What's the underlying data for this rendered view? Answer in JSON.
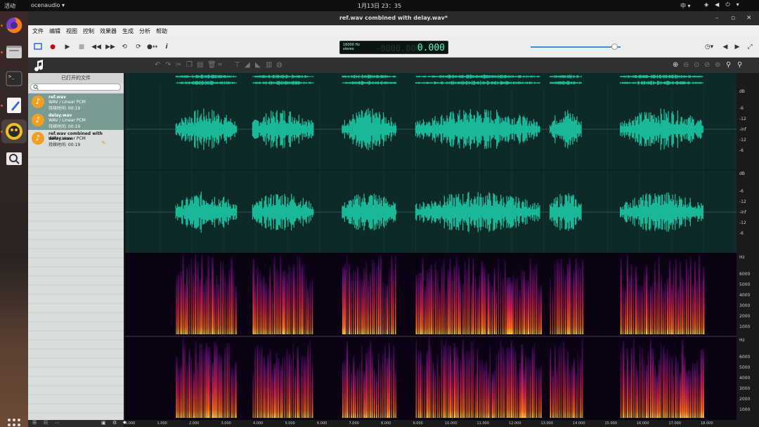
{
  "topbar": {
    "activities": "活动",
    "app_name": "ocenaudio ▾",
    "clock": "1月13日  23：35",
    "ime": "中 ▾",
    "tray_icons": [
      "network-icon",
      "volume-icon",
      "power-icon",
      "menu-arrow-icon"
    ]
  },
  "dock": {
    "items": [
      {
        "name": "firefox-icon"
      },
      {
        "name": "files-icon"
      },
      {
        "name": "terminal-icon"
      },
      {
        "name": "text-editor-icon"
      },
      {
        "name": "ocenaudio-icon"
      },
      {
        "name": "search-tool-icon"
      }
    ]
  },
  "window": {
    "title": "ref.wav combined with delay.wav*",
    "controls": {
      "minimize": "–",
      "maximize": "▫",
      "close": "✕"
    }
  },
  "menu": {
    "items": [
      "文件",
      "编辑",
      "视图",
      "控制",
      "效果器",
      "生成",
      "分析",
      "帮助"
    ]
  },
  "toolbar": {
    "lcd_rate": "16000 Hz",
    "lcd_channels": "stereo",
    "lcd_ghost": "-0000.000",
    "lcd_value": "0.000",
    "volume_level": 0.93
  },
  "sidebar": {
    "title": "已打开的文件",
    "search_placeholder": "",
    "files": [
      {
        "name": "ref.wav",
        "type": "WAV / Linear PCM",
        "duration": "持续时间: 00:19",
        "selected": true
      },
      {
        "name": "delay.wav",
        "type": "WAV / Linear PCM",
        "duration": "持续时间: 00:19",
        "selected": true
      },
      {
        "name": "ref.wav combined with delay.wav",
        "type": "WAV / Linear PCM",
        "duration": "持续时间: 00:19",
        "selected": false
      }
    ]
  },
  "waveform_scale": {
    "ch1": [
      "dB",
      "-6",
      "-12",
      "-inf",
      "-12",
      "-6"
    ],
    "ch2": [
      "dB",
      "-6",
      "-12",
      "-inf",
      "-12",
      "-6"
    ]
  },
  "spectrogram_scale": {
    "ch1": [
      "Hz",
      "6000",
      "5000",
      "4000",
      "3000",
      "2000",
      "1000"
    ],
    "ch2": [
      "Hz",
      "6000",
      "5000",
      "4000",
      "3000",
      "2000",
      "1000"
    ]
  },
  "timeline": {
    "labels": [
      "0.000",
      "1.000",
      "2.000",
      "3.000",
      "4.000",
      "5.000",
      "6.000",
      "7.000",
      "8.000",
      "9.000",
      "10.000",
      "11.000",
      "12.000",
      "13.000",
      "14.000",
      "15.000",
      "16.000",
      "17.000",
      "18.000"
    ]
  },
  "audio_segments_seconds": [
    [
      1.5,
      3.4
    ],
    [
      3.9,
      5.8
    ],
    [
      6.7,
      8.4
    ],
    [
      9.0,
      12.9
    ],
    [
      13.2,
      14.2
    ],
    [
      15.4,
      18.0
    ]
  ],
  "colors": {
    "wave": "#19b899",
    "wave_bg": "#0d2a28",
    "lcd_text": "#4dffc0",
    "selection": "#7a9a96"
  }
}
